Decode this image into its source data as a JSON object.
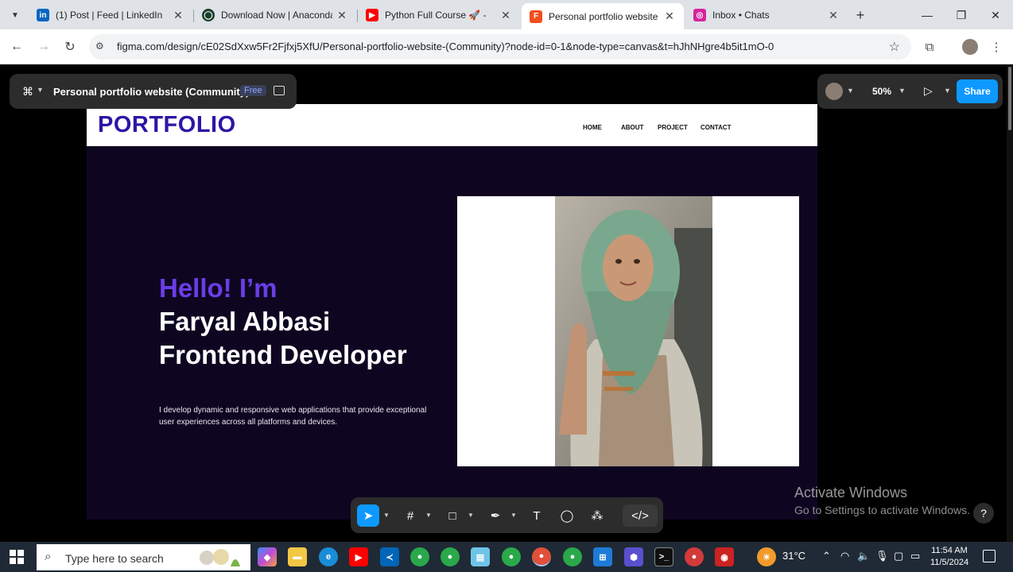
{
  "browser": {
    "tabs": [
      {
        "title": "(1) Post | Feed | LinkedIn",
        "icon": "linkedin-icon",
        "color": "#0a66c2"
      },
      {
        "title": "Download Now | Anaconda",
        "icon": "anaconda-icon",
        "color": "#1a3d2a"
      },
      {
        "title": "Python Full Course 🚀 -",
        "icon": "youtube-icon",
        "color": "#ff0000"
      },
      {
        "title": "Personal portfolio website (",
        "icon": "figma-icon",
        "color": "#f24e1e"
      },
      {
        "title": "Inbox • Chats",
        "icon": "instagram-icon",
        "color": "#d6249f"
      }
    ],
    "url": "figma.com/design/cE02SdXxw5Fr2Fjfxj5XfU/Personal-portfolio-website-(Community)?node-id=0-1&node-type=canvas&t=hJhNHgre4b5it1mO-0"
  },
  "figma": {
    "file_name": "Personal portfolio website (Community)",
    "plan_badge": "Free",
    "zoom": "50%",
    "share_label": "Share"
  },
  "design": {
    "brand": "PORTFOLIO",
    "nav": [
      "HOME",
      "ABOUT",
      "PROJECT",
      "CONTACT"
    ],
    "hello": "Hello! I’m",
    "name": "Faryal Abbasi",
    "role": "Frontend Developer",
    "description": "I develop dynamic and responsive web applications that provide exceptional user experiences across all platforms and devices.",
    "colors": {
      "brand": "#2b17a6",
      "accent": "#6a3de8",
      "background": "#0e0621"
    }
  },
  "windows": {
    "activate_title": "Activate Windows",
    "activate_sub": "Go to Settings to activate Windows.",
    "search_placeholder": "Type here to search",
    "temperature": "31°C",
    "time": "11:54 AM",
    "date": "11/5/2024"
  }
}
